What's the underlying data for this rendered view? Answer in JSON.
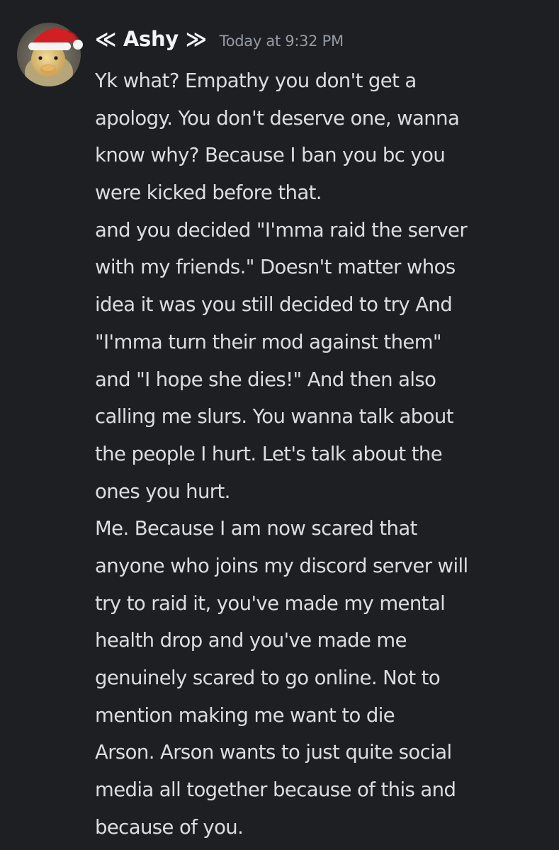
{
  "message": {
    "author": "≪ Ashy ≫",
    "timestamp": "Today at 9:32 PM",
    "lines": [
      "Yk what? Empathy you don't get a",
      "apology. You don't deserve one, wanna",
      "know why? Because I ban you bc you",
      "were kicked before that.",
      "and you decided \"I'mma raid the server",
      "with my friends.\" Doesn't matter whos",
      "idea it was you still decided to try And",
      "\"I'mma turn their mod against them\"",
      "and \"I hope she dies!\" And then also",
      "calling me slurs. You wanna talk about",
      "the people I hurt. Let's talk about the",
      "ones you hurt.",
      "Me. Because I am now scared that",
      "anyone who joins my discord server will",
      "try to raid it, you've made my mental",
      "health drop and you've made me",
      "genuinely scared to go online. Not to",
      "mention making me want to die",
      "Arson. Arson wants to just quite social",
      "media all together because of this and",
      "because of you."
    ]
  },
  "colors": {
    "background": "#1e1f22",
    "text": "#dbdee1",
    "username": "#f2f3f5",
    "timestamp": "#949ba4"
  },
  "icons": {
    "avatar": "duck-with-santa-hat-avatar"
  }
}
